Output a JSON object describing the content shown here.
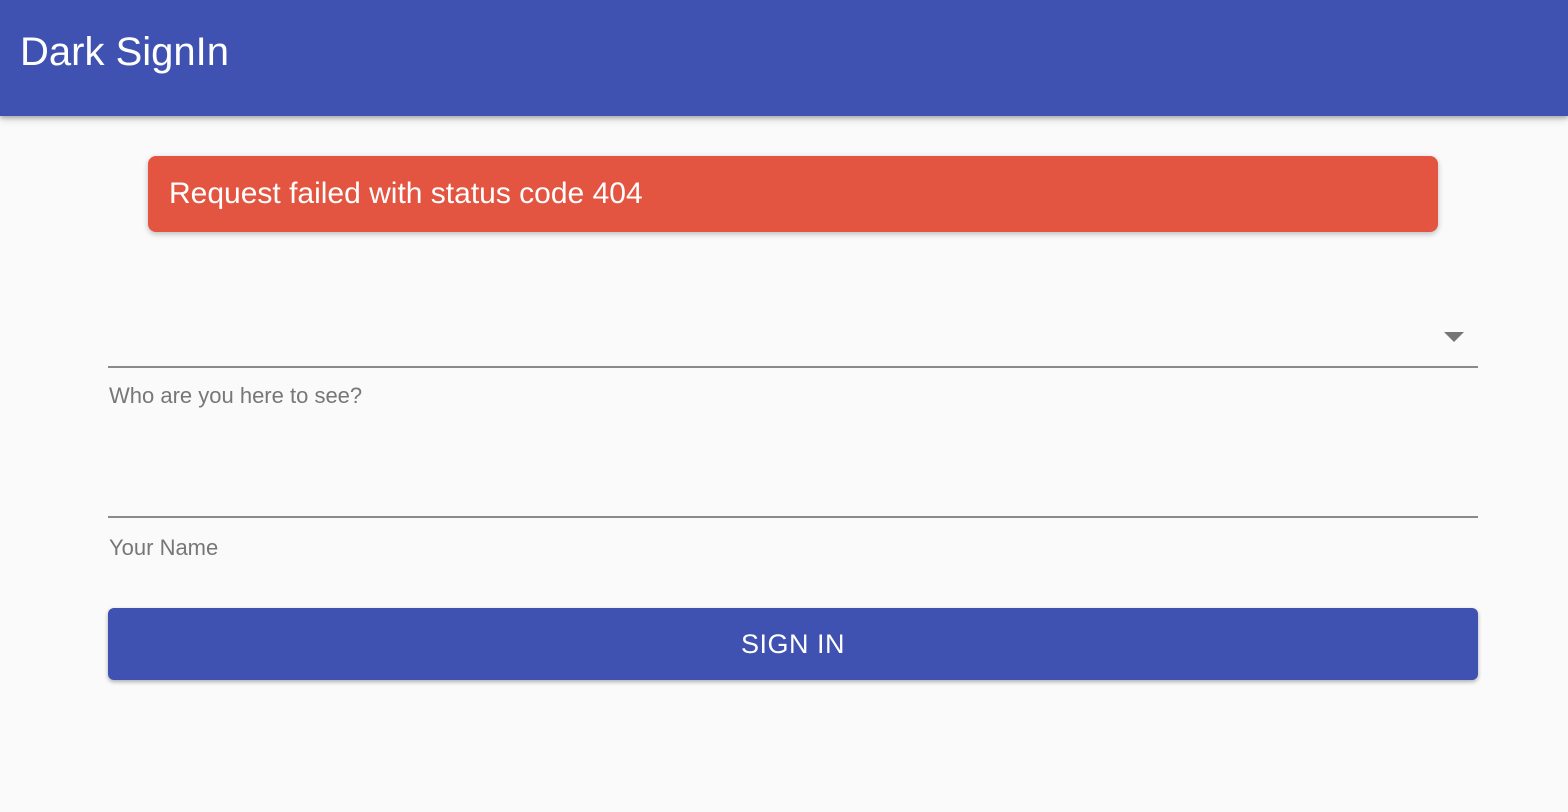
{
  "app": {
    "title": "Dark SignIn",
    "accent_color": "#3f51b1"
  },
  "alert": {
    "message": "Request failed with status code 404",
    "color": "#e35441"
  },
  "form": {
    "host_select": {
      "label": "Who are you here to see?",
      "value": "",
      "icon": "arrow-drop-down-icon"
    },
    "name_field": {
      "label": "Your Name",
      "value": ""
    },
    "submit_label": "SIGN IN"
  }
}
